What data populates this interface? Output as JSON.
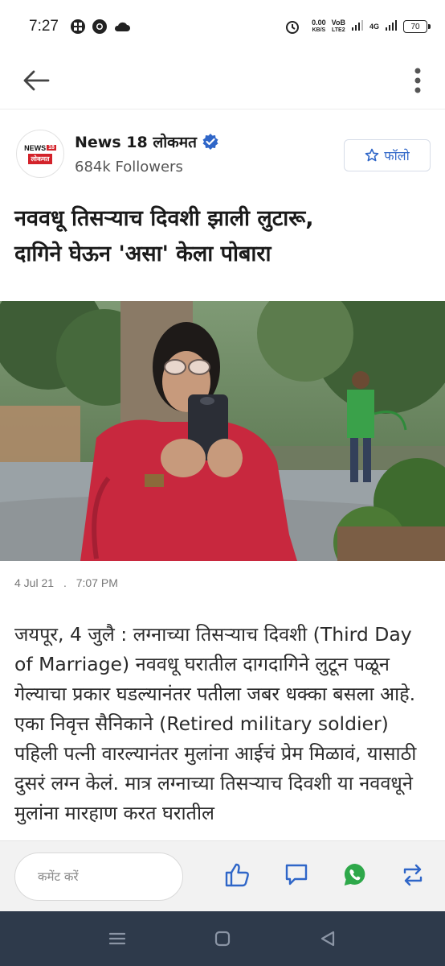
{
  "status_bar": {
    "time": "7:27",
    "data_speed_value": "0.00",
    "data_speed_unit": "KB/S",
    "volte_top": "VoB",
    "volte_bottom": "LTE2",
    "network": "4G",
    "battery": "70"
  },
  "publisher": {
    "logo_top": "NEWS",
    "logo_badge": "18",
    "logo_bottom": "लोकमत",
    "name": "News 18 लोकमत",
    "followers": "684k Followers",
    "follow_label": "फॉलो"
  },
  "article": {
    "headline_line1": "नववधू तिसऱ्याच दिवशी झाली लुटारू,",
    "headline_line2": "दागिने घेऊन 'असा' केला पोबारा",
    "date": "4 Jul 21",
    "separator": ".",
    "time": "7:07 PM",
    "body": "जयपूर, 4 जुलै : लग्नाच्या तिसऱ्याच दिवशी (Third Day of Marriage) नववधू घरातील दागदागिने लुटून पळून गेल्याचा प्रकार घडल्यानंतर पतीला जबर धक्का बसला आहे. एका निवृत्त सैनिकाने (Retired military soldier) पहिली पत्नी वारल्यानंतर मुलांना आईचं प्रेम मिळावं, यासाठी दुसरं लग्न केलं. मात्र लग्नाच्या तिसऱ्याच दिवशी या नववधूने मुलांना मारहाण करत घरातील"
  },
  "bottom_bar": {
    "comment_placeholder": "कमेंट करें"
  },
  "icons": {
    "back": "back-arrow-icon",
    "more": "more-vertical-icon",
    "verified": "verified-badge-icon",
    "follow": "star-icon",
    "like": "thumbs-up-icon",
    "comment": "comment-icon",
    "whatsapp": "whatsapp-icon",
    "repost": "repost-icon"
  },
  "colors": {
    "accent_blue": "#2f66c8",
    "whatsapp_green": "#2ea84a",
    "brand_red": "#d3222a",
    "nav_bar": "#2e3a4b"
  }
}
